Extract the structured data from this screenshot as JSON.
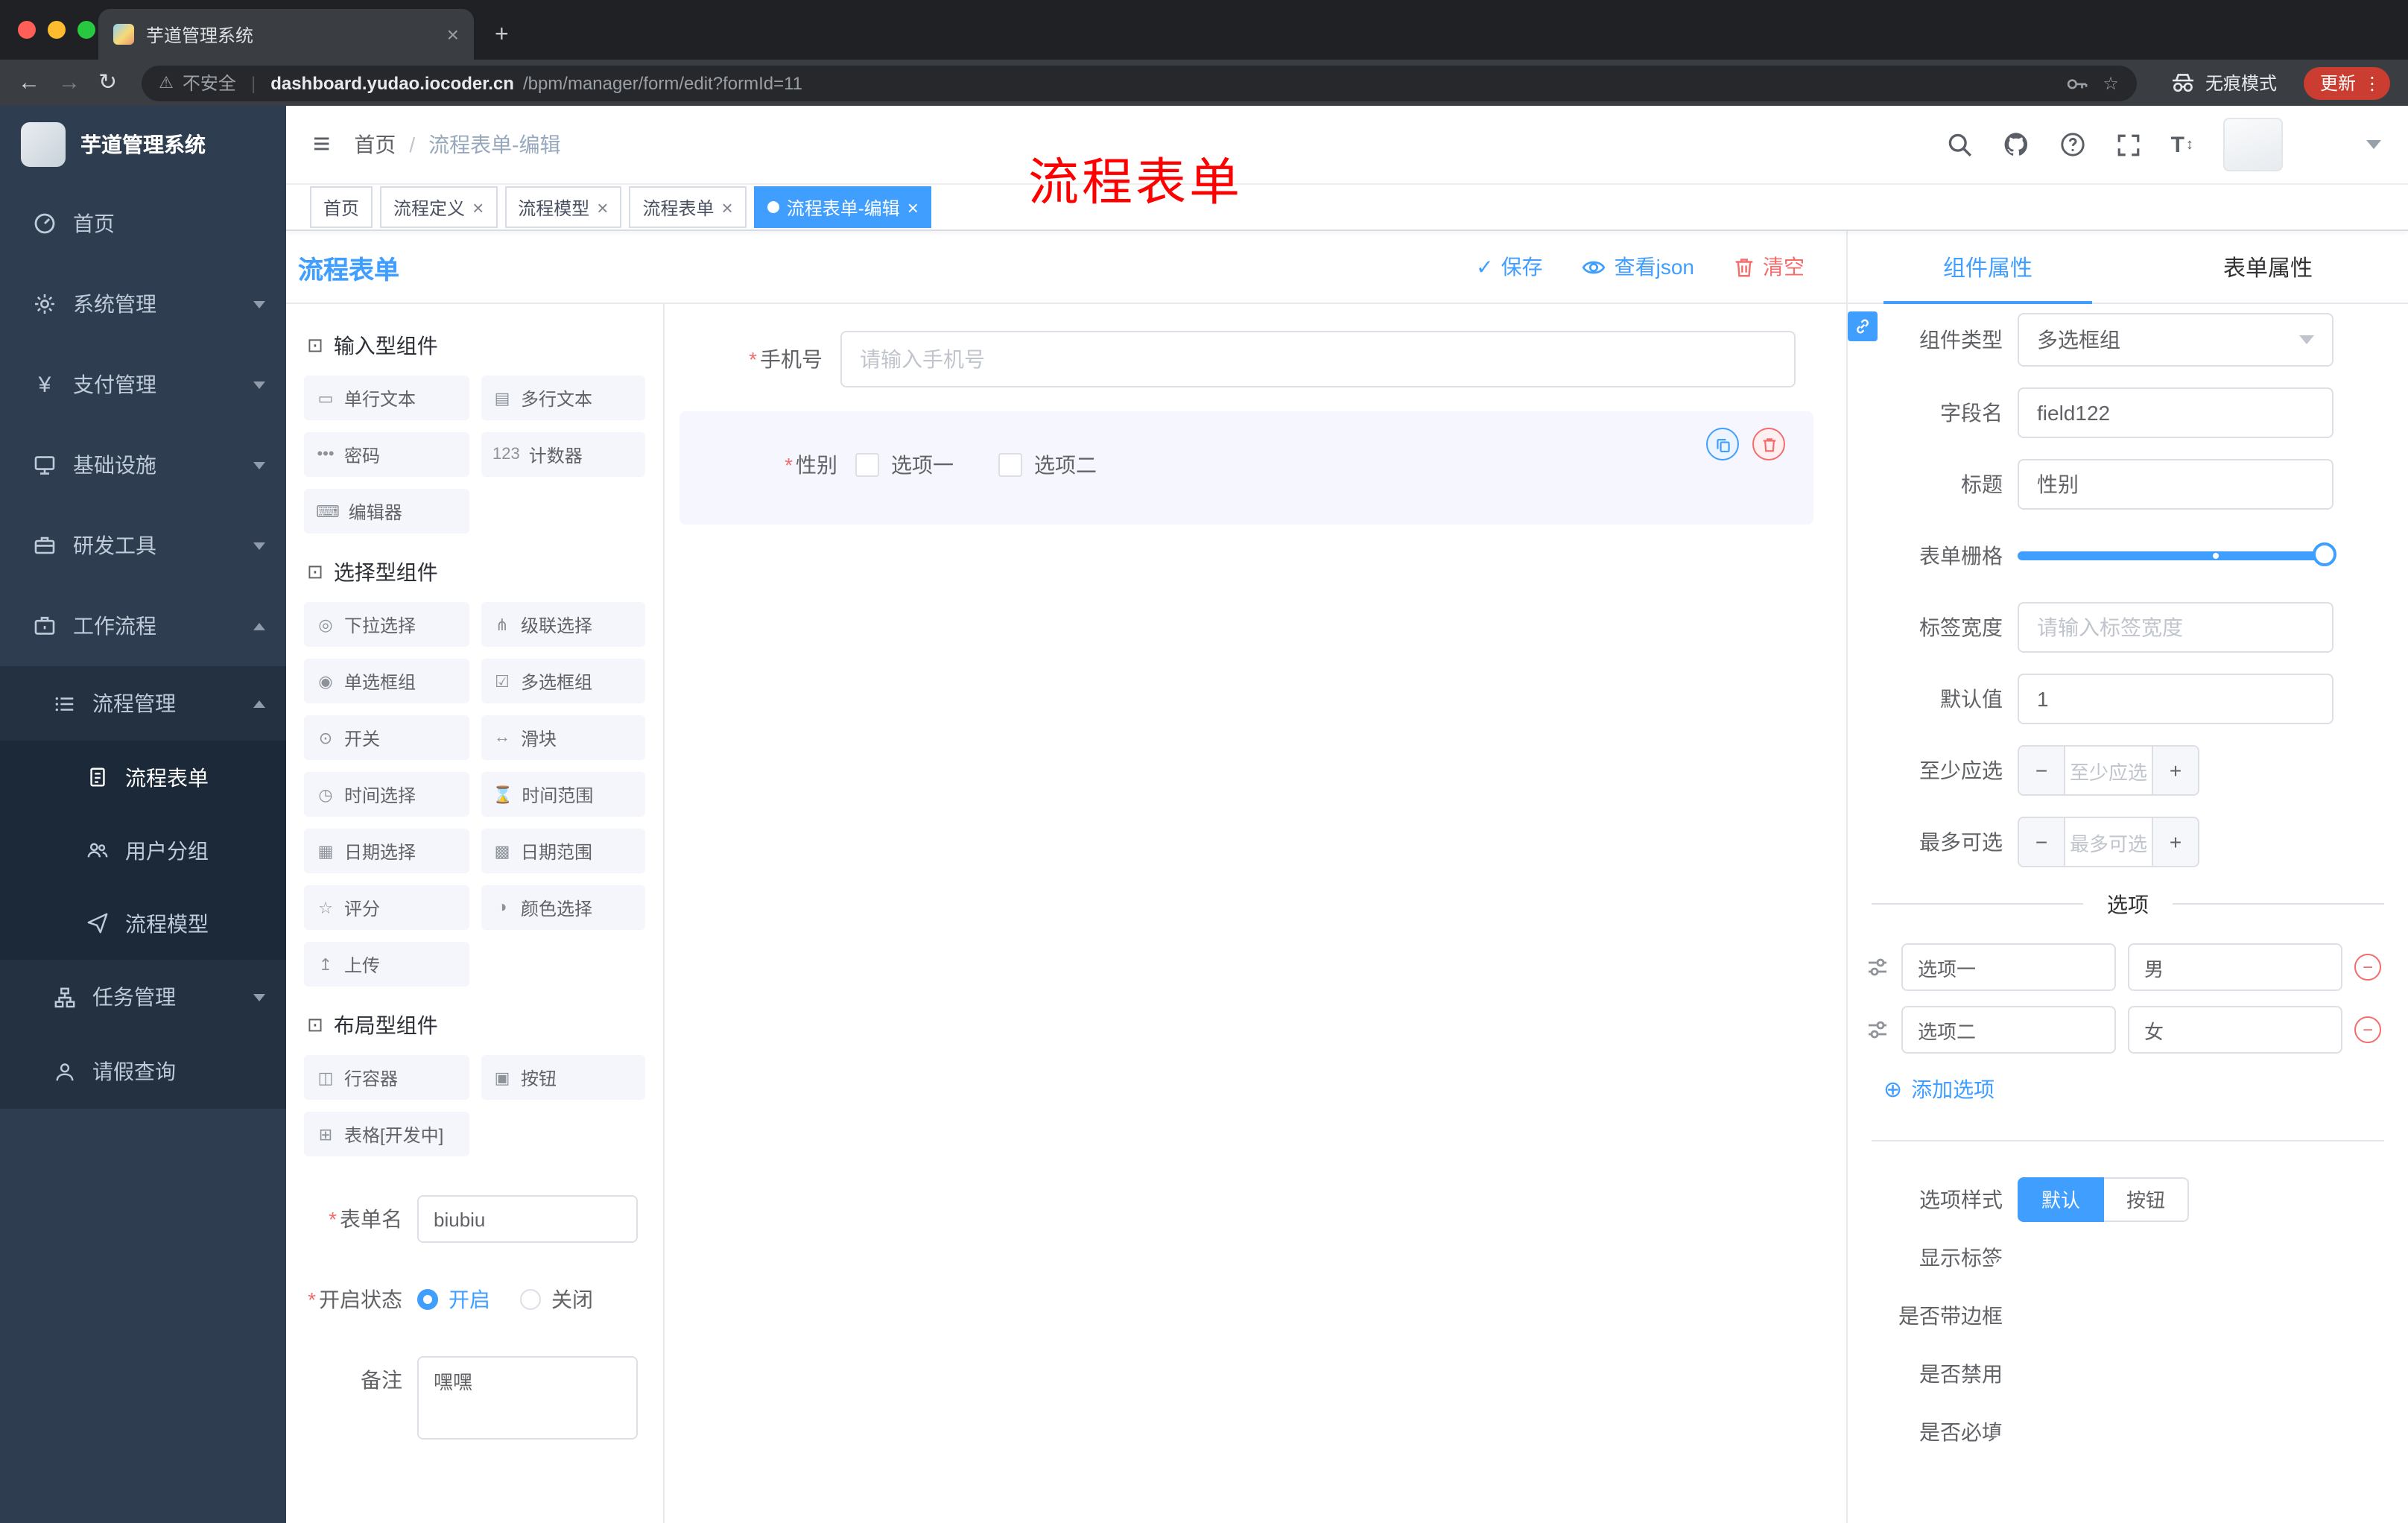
{
  "glyphs": {
    "close": "×",
    "plus": "+",
    "minus": "−",
    "kebab": "⋮",
    "check": "✓",
    "slash": "/",
    "asterisk": "*",
    "back": "←",
    "forward": "→",
    "reload": "↻",
    "star": "☆",
    "warning": "⚠",
    "pipe": "|",
    "add_circle": "⊕",
    "hamburger": "≡",
    "size_t": "T",
    "size_arrows": "↕",
    "yen": "¥"
  },
  "browser": {
    "tab_title": "芋道管理系统",
    "security": "不安全",
    "host": "dashboard.yudao.iocoder.cn",
    "path": "/bpm/manager/form/edit?formId=11",
    "incognito": "无痕模式",
    "update": "更新"
  },
  "annotation": {
    "text": "流程表单"
  },
  "sidebar": {
    "logo": "芋道管理系统",
    "menu": [
      {
        "label": "首页",
        "icon": "dashboard-icon"
      },
      {
        "label": "系统管理",
        "icon": "gear-icon"
      },
      {
        "label": "支付管理",
        "icon": "yen-icon"
      },
      {
        "label": "基础设施",
        "icon": "infra-icon"
      },
      {
        "label": "研发工具",
        "icon": "tools-icon"
      },
      {
        "label": "工作流程",
        "icon": "workflow-icon"
      }
    ],
    "submenu": {
      "group_label": "流程管理",
      "children": [
        {
          "label": "流程表单",
          "active": true
        },
        {
          "label": "用户分组",
          "active": false
        },
        {
          "label": "流程模型",
          "active": false
        }
      ],
      "task_label": "任务管理",
      "leave_label": "请假查询"
    }
  },
  "navbar": {
    "breadcrumb": {
      "home": "首页",
      "current": "流程表单-编辑"
    }
  },
  "tags": [
    {
      "label": "首页"
    },
    {
      "label": "流程定义"
    },
    {
      "label": "流程模型"
    },
    {
      "label": "流程表单"
    },
    {
      "label": "流程表单-编辑"
    }
  ],
  "designer": {
    "title": "流程表单",
    "actions": {
      "save": "保存",
      "view_json": "查看json",
      "clear": "清空"
    },
    "palette": [
      {
        "title": "输入型组件",
        "items": [
          {
            "label": "单行文本",
            "icon": "input"
          },
          {
            "label": "多行文本",
            "icon": "textarea"
          },
          {
            "label": "密码",
            "icon": "password"
          },
          {
            "label": "计数器",
            "icon": "counter"
          },
          {
            "label": "编辑器",
            "icon": "editor"
          }
        ]
      },
      {
        "title": "选择型组件",
        "items": [
          {
            "label": "下拉选择",
            "icon": "select"
          },
          {
            "label": "级联选择",
            "icon": "cascader"
          },
          {
            "label": "单选框组",
            "icon": "radio"
          },
          {
            "label": "多选框组",
            "icon": "checkbox"
          },
          {
            "label": "开关",
            "icon": "switch"
          },
          {
            "label": "滑块",
            "icon": "slider"
          },
          {
            "label": "时间选择",
            "icon": "time"
          },
          {
            "label": "时间范围",
            "icon": "time-range"
          },
          {
            "label": "日期选择",
            "icon": "date"
          },
          {
            "label": "日期范围",
            "icon": "date-range"
          },
          {
            "label": "评分",
            "icon": "rate"
          },
          {
            "label": "颜色选择",
            "icon": "color"
          },
          {
            "label": "上传",
            "icon": "upload"
          }
        ]
      },
      {
        "title": "布局型组件",
        "items": [
          {
            "label": "行容器",
            "icon": "row"
          },
          {
            "label": "按钮",
            "icon": "button"
          },
          {
            "label": "表格[开发中]",
            "icon": "table"
          }
        ]
      }
    ],
    "meta_form": {
      "name_label": "表单名",
      "name_value": "biubiu",
      "status_label": "开启状态",
      "status_on": "开启",
      "status_off": "关闭",
      "remark_label": "备注",
      "remark_value": "嘿嘿"
    },
    "canvas": {
      "phone_label": "手机号",
      "phone_placeholder": "请输入手机号",
      "gender_label": "性别",
      "gender_options": [
        "选项一",
        "选项二"
      ]
    }
  },
  "props": {
    "tabs": [
      "组件属性",
      "表单属性"
    ],
    "rows": {
      "type_label": "组件类型",
      "type_value": "多选框组",
      "field_label": "字段名",
      "field_value": "field122",
      "title_label": "标题",
      "title_value": "性别",
      "grid_label": "表单栅格",
      "width_label": "标签宽度",
      "width_placeholder": "请输入标签宽度",
      "default_label": "默认值",
      "default_value": "1",
      "min_label": "至少应选",
      "min_placeholder": "至少应选",
      "max_label": "最多可选",
      "max_placeholder": "最多可选"
    },
    "options_divider": "选项",
    "options": [
      {
        "label": "选项一",
        "value": "男"
      },
      {
        "label": "选项二",
        "value": "女"
      }
    ],
    "add_option": "添加选项",
    "style_label": "选项样式",
    "style_options": [
      "默认",
      "按钮"
    ],
    "switches": [
      {
        "label": "显示标签",
        "on": true
      },
      {
        "label": "是否带边框",
        "on": false
      },
      {
        "label": "是否禁用",
        "on": false
      },
      {
        "label": "是否必填",
        "on": true
      }
    ]
  },
  "colors": {
    "accent": "#409eff",
    "danger": "#f56c6c",
    "sidebar_bg": "#2e3e50"
  }
}
